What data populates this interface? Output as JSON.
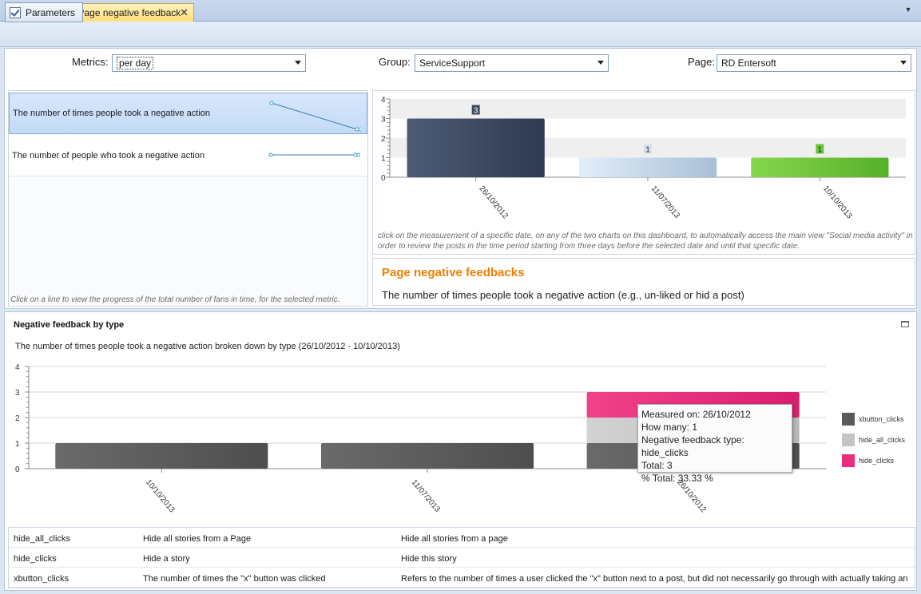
{
  "window": {
    "tab_title": "Facebook | Page negative feedback",
    "tab_close": "✕",
    "tab_menu": "▼"
  },
  "toolbar": {
    "parameters_label": "Parameters"
  },
  "filters": {
    "metrics_label": "Metrics:",
    "metrics_value": "per day",
    "group_label": "Group:",
    "group_value": "ServiceSupport",
    "page_label": "Page:",
    "page_value": "RD Entersoft"
  },
  "metric_list": {
    "items": [
      {
        "label": "The number of times people took a negative action",
        "selected": true
      },
      {
        "label": "The number of people who took a negative action",
        "selected": false
      }
    ],
    "hint": "Click on a line to view the progress of the total number of fans in time, for the selected metric."
  },
  "chart1": {
    "hint": "click on the measurement of a specific date, on any of the two charts on this dashboard, to automatically access the main view \"Social media activity\" in order to review the posts in the time period starting from three days before the selected date and until that specific date."
  },
  "info": {
    "title": "Page negative feedbacks",
    "description": "The number of times people took a negative action (e.g., un-liked or hid a post)"
  },
  "feedback_section": {
    "title": "Negative feedback by type",
    "subtitle": "The number of times people took a negative action broken down by type (26/10/2012 - 10/10/2013)"
  },
  "tooltip": {
    "lines": [
      "Measured on: 26/10/2012",
      "How many: 1",
      "Negative feedback type: hide_clicks",
      "Total: 3",
      "% Total: 33.33 %"
    ]
  },
  "types_table": {
    "rows": [
      {
        "type": "hide_all_clicks",
        "title": "Hide all stories from a Page",
        "description": "Hide all stories from a page"
      },
      {
        "type": "hide_clicks",
        "title": "Hide a story",
        "description": "Hide this story"
      },
      {
        "type": "xbutton_clicks",
        "title": "The number of times the \"x\" button was clicked",
        "description": "Refers to the number of times a user clicked the \"x\" button next to a post, but did not necessarily go through with actually taking an"
      }
    ]
  },
  "chart_data": [
    {
      "type": "bar",
      "categories": [
        "26/10/2012",
        "11/07/2013",
        "10/10/2013"
      ],
      "values": [
        3,
        1,
        1
      ],
      "data_labels": [
        "3",
        "1",
        "1"
      ],
      "colors": [
        "#3d4a62",
        "#c3d6ea",
        "#6ac43a"
      ],
      "ylim": [
        0,
        4
      ],
      "yticks": [
        "0",
        "1",
        "2",
        "3",
        "4"
      ],
      "grid": "alternate bands"
    },
    {
      "type": "bar",
      "stacked": true,
      "categories": [
        "10/10/2013",
        "11/07/2013",
        "26/10/2012"
      ],
      "series": [
        {
          "name": "xbutton_clicks",
          "color": "#5a5a5a",
          "values": [
            1,
            1,
            1
          ]
        },
        {
          "name": "hide_all_clicks",
          "color": "#c4c4c4",
          "values": [
            0,
            0,
            1
          ]
        },
        {
          "name": "hide_clicks",
          "color": "#ea2d7c",
          "values": [
            0,
            0,
            1
          ]
        }
      ],
      "ylim": [
        0,
        4
      ],
      "yticks": [
        "0",
        "1",
        "2",
        "3",
        "4"
      ],
      "legend": "right"
    }
  ]
}
